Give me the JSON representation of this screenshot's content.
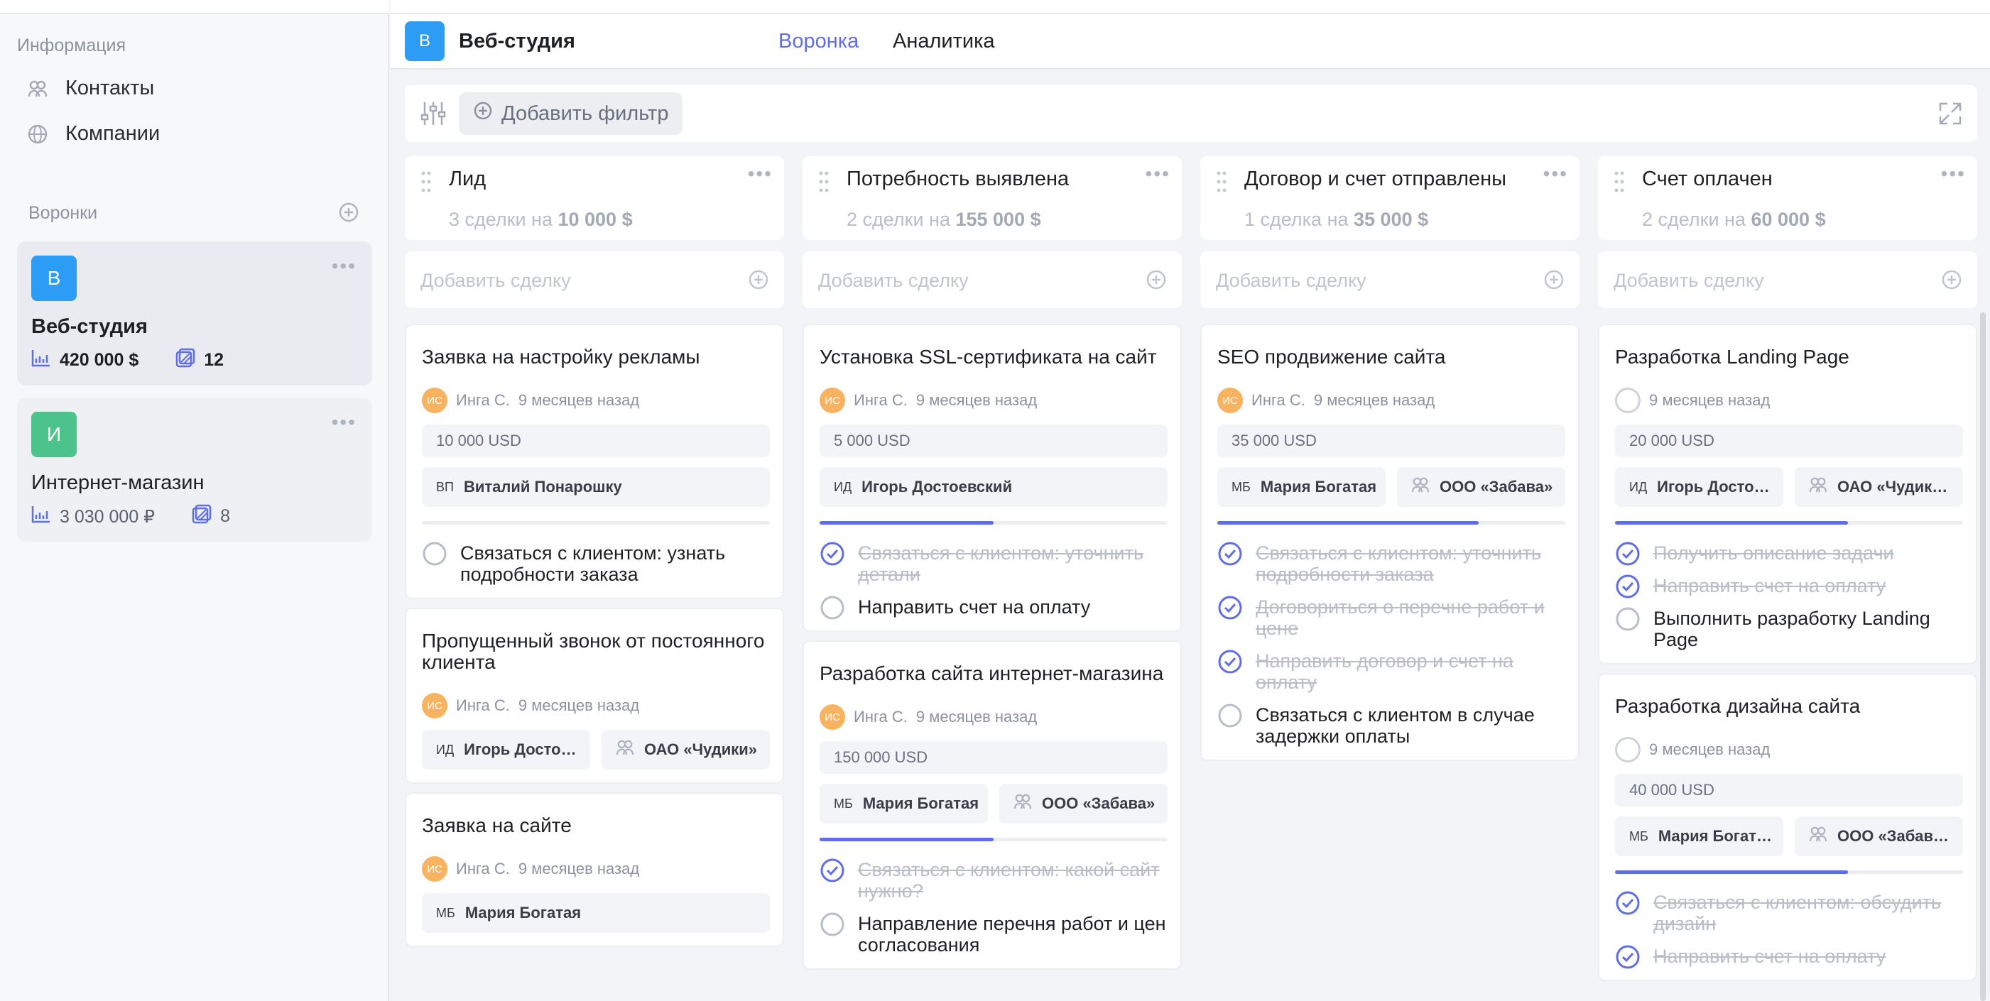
{
  "sidebar": {
    "info_title": "Информация",
    "contacts": "Контакты",
    "companies": "Компании",
    "funnels_title": "Воронки",
    "funnels": [
      {
        "initial": "В",
        "name": "Веб-студия",
        "amount": "420 000 $",
        "count": "12",
        "color": "#2d9cf5"
      },
      {
        "initial": "И",
        "name": "Интернет-магазин",
        "amount": "3 030 000 ₽",
        "count": "8",
        "color": "#4cc38a"
      }
    ]
  },
  "topbar": {
    "initial": "В",
    "title": "Веб-студия",
    "tabs": [
      "Воронка",
      "Аналитика"
    ]
  },
  "filter": {
    "add_label": "Добавить фильтр"
  },
  "add_deal_label": "Добавить сделку",
  "columns": [
    {
      "title": "Лид",
      "sum_prefix": "3 сделки на",
      "sum_value": "10 000 $",
      "cards": [
        {
          "title": "Заявка на настройку рекламы",
          "avatar": "ИС",
          "author": "Инга С.",
          "time": "9 месяцев назад",
          "amount": "10 000 USD",
          "contact_ini": "ВП",
          "contact": "Виталий Понарошку",
          "progress": 0,
          "tasks": [
            {
              "text": "Связаться с клиентом: узнать подробности заказа",
              "done": false
            }
          ]
        },
        {
          "title": "Пропущенный звонок от постоянного клиента",
          "avatar": "ИС",
          "author": "Инга С.",
          "time": "9 месяцев назад",
          "contact_ini": "ИД",
          "contact": "Игорь Досто…",
          "company": "ОАО «Чудики»"
        },
        {
          "title": "Заявка на сайте",
          "avatar": "ИС",
          "author": "Инга С.",
          "time": "9 месяцев назад",
          "contact_ini": "МБ",
          "contact": "Мария Богатая"
        }
      ]
    },
    {
      "title": "Потребность выявлена",
      "sum_prefix": "2 сделки на",
      "sum_value": "155 000 $",
      "cards": [
        {
          "title": "Установка SSL-сертификата на сайт",
          "avatar": "ИС",
          "author": "Инга С.",
          "time": "9 месяцев назад",
          "amount": "5 000 USD",
          "contact_ini": "ИД",
          "contact": "Игорь Достоевский",
          "progress": 0.5,
          "tasks": [
            {
              "text": "Связаться с клиентом: уточнить детали",
              "done": true
            },
            {
              "text": "Направить счет на оплату",
              "done": false
            }
          ]
        },
        {
          "title": "Разработка сайта интернет-магазина",
          "avatar": "ИС",
          "author": "Инга С.",
          "time": "9 месяцев назад",
          "amount": "150 000 USD",
          "contact_ini": "МБ",
          "contact": "Мария Богатая",
          "company": "ООО «Забава»",
          "progress": 0.5,
          "tasks": [
            {
              "text": "Связаться с клиентом: какой сайт нужно?",
              "done": true
            },
            {
              "text": "Направление перечня работ и цен согласования",
              "done": false
            }
          ]
        }
      ]
    },
    {
      "title": "Договор и счет отправлены",
      "sum_prefix": "1 сделка на",
      "sum_value": "35 000 $",
      "cards": [
        {
          "title": "SEO продвижение сайта",
          "avatar": "ИС",
          "author": "Инга С.",
          "time": "9 месяцев назад",
          "amount": "35 000 USD",
          "contact_ini": "МБ",
          "contact": "Мария Богатая",
          "company": "ООО «Забава»",
          "progress": 0.75,
          "tasks": [
            {
              "text": "Связаться с клиентом: уточнить подробности заказа",
              "done": true
            },
            {
              "text": "Договориться о перечне работ и цене",
              "done": true
            },
            {
              "text": "Направить договор и счет на оплату",
              "done": true
            },
            {
              "text": "Связаться с клиентом в случае задержки оплаты",
              "done": false
            }
          ]
        }
      ]
    },
    {
      "title": "Счет оплачен",
      "sum_prefix": "2 сделки на",
      "sum_value": "60 000 $",
      "cards": [
        {
          "title": "Разработка Landing Page",
          "time": "9 месяцев назад",
          "amount": "20 000 USD",
          "contact_ini": "ИД",
          "contact": "Игорь Досто…",
          "company": "ОАО «Чудик…",
          "progress": 0.667,
          "tasks": [
            {
              "text": "Получить описание задачи",
              "done": true
            },
            {
              "text": "Направить счет на оплату",
              "done": true
            },
            {
              "text": "Выполнить разработку Landing Page",
              "done": false
            }
          ]
        },
        {
          "title": "Разработка дизайна сайта",
          "time": "9 месяцев назад",
          "amount": "40 000 USD",
          "contact_ini": "МБ",
          "contact": "Мария Богат…",
          "company": "ООО «Забав…",
          "progress": 0.667,
          "tasks": [
            {
              "text": "Связаться с клиентом: обсудить дизайн",
              "done": true
            },
            {
              "text": "Направить счет на оплату",
              "done": true
            }
          ]
        }
      ]
    }
  ],
  "colors": {
    "accent": "#5f6ee6",
    "avatar": "#f7b35f"
  }
}
